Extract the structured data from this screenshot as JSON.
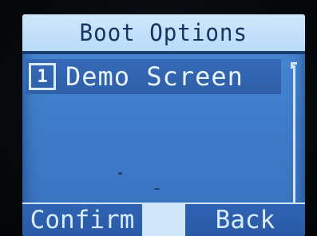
{
  "screen": {
    "title": "Boot Options"
  },
  "menu": {
    "items": [
      {
        "number": "1",
        "label": "Demo Screen",
        "selected": true
      }
    ]
  },
  "softkeys": {
    "left_label": "Confirm",
    "right_label": "Back"
  },
  "colors": {
    "screen_bg": "#3f7cc9",
    "title_bg": "#cfe6fb",
    "title_text": "#16345f",
    "highlight": "#2f5fa9",
    "text_light": "#e8f4ff"
  }
}
